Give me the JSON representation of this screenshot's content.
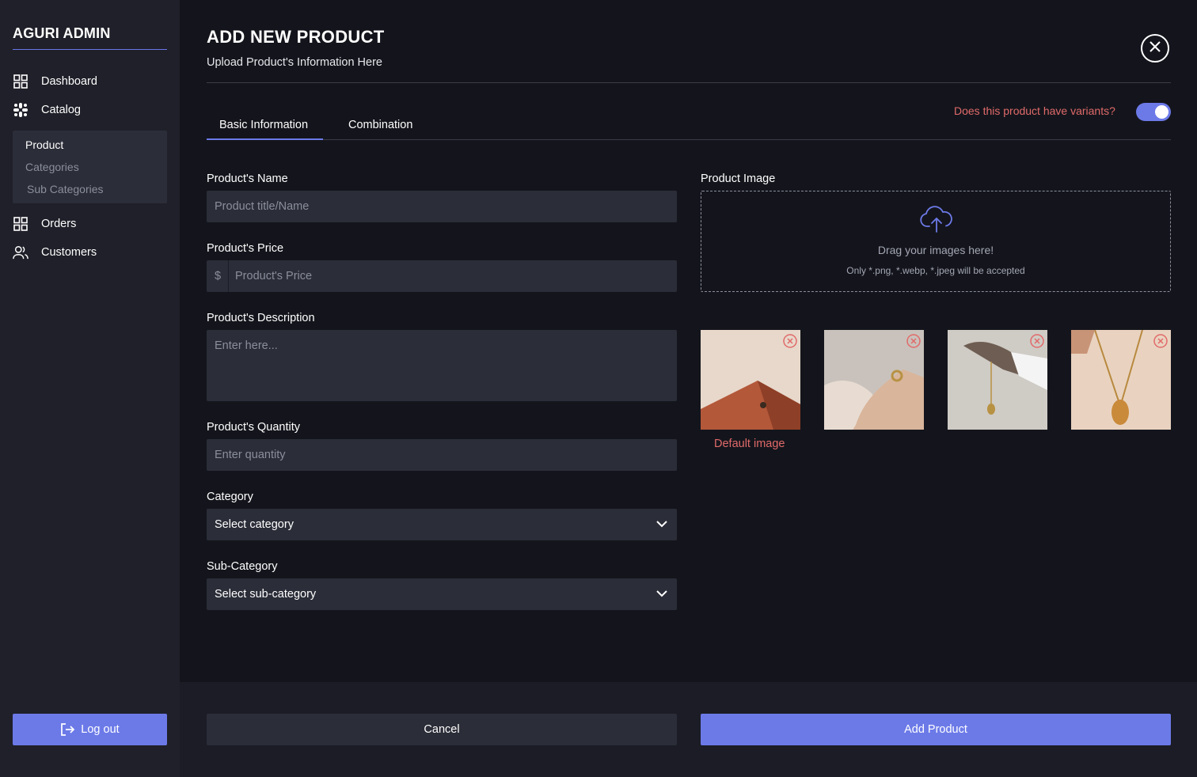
{
  "sidebar": {
    "brand": "AGURI ADMIN",
    "nav": {
      "dashboard": "Dashboard",
      "catalog": "Catalog",
      "orders": "Orders",
      "customers": "Customers"
    },
    "catalog_submenu": [
      "Product",
      "Categories",
      "Sub Categories"
    ],
    "logout_label": "Log out"
  },
  "header": {
    "title": "ADD NEW PRODUCT",
    "subtitle": "Upload Product's Information Here"
  },
  "tabs": [
    "Basic Information",
    "Combination"
  ],
  "variants": {
    "label": "Does this product have variants?",
    "enabled": true
  },
  "form": {
    "name": {
      "label": "Product's Name",
      "placeholder": "Product title/Name"
    },
    "price": {
      "label": "Product's Price",
      "currency": "$",
      "placeholder": "Product's Price"
    },
    "description": {
      "label": "Product's Description",
      "placeholder": "Enter here..."
    },
    "quantity": {
      "label": "Product's Quantity",
      "placeholder": "Enter quantity"
    },
    "category": {
      "label": "Category",
      "selected": "Select category"
    },
    "subcategory": {
      "label": "Sub-Category",
      "selected": "Select sub-category"
    }
  },
  "image": {
    "label": "Product Image",
    "drop_text": "Drag your images here!",
    "drop_hint": "Only *.png, *.webp, *.jpeg will be accepted",
    "default_label": "Default image"
  },
  "actions": {
    "cancel": "Cancel",
    "add": "Add Product"
  },
  "colors": {
    "accent": "#6c7ae8",
    "danger": "#e16a6a",
    "panel": "#14151c",
    "input": "#2b2d38"
  }
}
